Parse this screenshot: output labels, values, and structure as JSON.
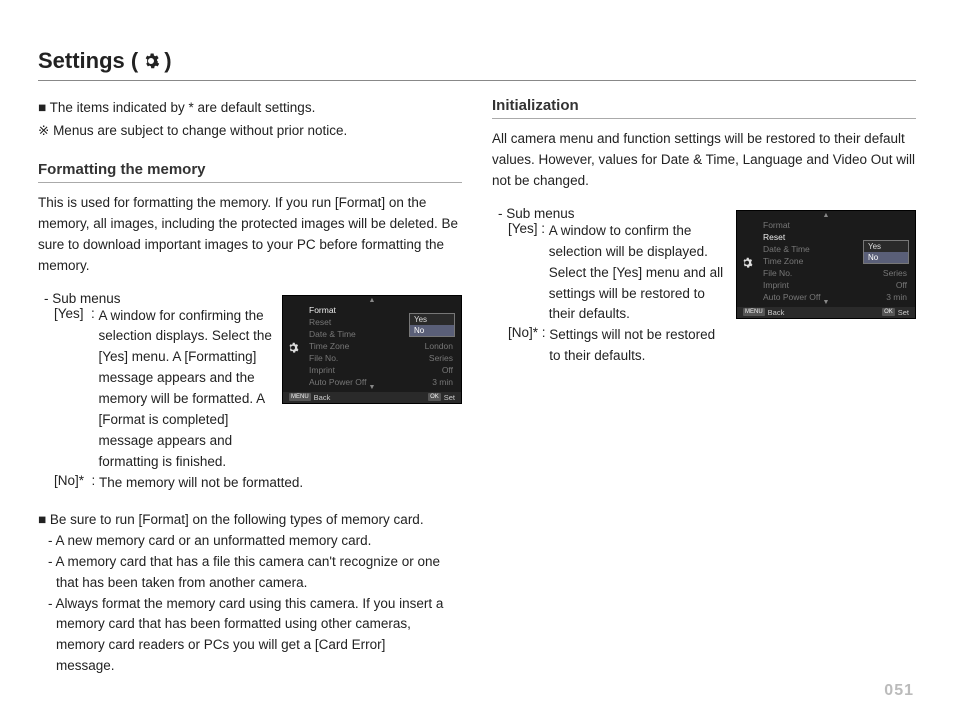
{
  "title_prefix": "Settings ( ",
  "title_suffix": " )",
  "left": {
    "note1_prefix": "■ ",
    "note1": "The items indicated by * are default settings.",
    "note2_prefix": "※ ",
    "note2": "Menus are subject to change without prior notice.",
    "h_format": "Formatting the memory",
    "format_desc": "This is used for formatting the memory. If you run [Format] on the memory, all images, including the protected images will be deleted. Be sure to download important images to your PC before formatting the memory.",
    "sub_label": "- Sub menus",
    "yes_key": "[Yes]  : ",
    "yes_val": "A window for confirming the selection displays. Select the [Yes] menu. A [Formatting] message appears and the memory will be formatted. A [Format is completed] message appears and formatting is finished.",
    "no_key": "[No]*  : ",
    "no_val": "The memory will not be formatted.",
    "n2_lead_prefix": "■ ",
    "n2_lead": "Be sure to run [Format] on the following types of memory card.",
    "n2_a": "- A new memory card or an unformatted memory card.",
    "n2_b": "- A memory card that has a file this camera can't recognize or one",
    "n2_b2": "that has been taken from another camera.",
    "n2_c": "- Always format the memory card using this camera. If you insert a",
    "n2_c2": "memory card that has been formatted using other cameras,",
    "n2_c3": "memory card readers or PCs you will get a [Card Error]",
    "n2_c4": "message."
  },
  "right": {
    "h_init": "Initialization",
    "init_desc": "All camera menu and function settings will be restored to their default values. However, values for Date & Time, Language and Video Out will not be changed.",
    "sub_label": "- Sub menus",
    "yes_key": "[Yes] : ",
    "yes_val": "A window to confirm the selection will be displayed. Select the [Yes] menu and all settings will be restored to their defaults.",
    "no_key": "[No]* : ",
    "no_val": "Settings will not be restored to their defaults."
  },
  "cam_menu": {
    "items": [
      {
        "label": "Format",
        "value": ""
      },
      {
        "label": "Reset",
        "value": ""
      },
      {
        "label": "Date & Time",
        "value": ""
      },
      {
        "label": "Time Zone",
        "value": "London"
      },
      {
        "label": "File No.",
        "value": "Series"
      },
      {
        "label": "Imprint",
        "value": "Off"
      },
      {
        "label": "Auto Power Off",
        "value": "3 min"
      }
    ],
    "opt_yes": "Yes",
    "opt_no": "No",
    "bar_back_key": "MENU",
    "bar_back": "Back",
    "bar_set_key": "OK",
    "bar_set": "Set"
  },
  "cam_menu_left_hot_index": 0,
  "cam_menu_right_hot_index": 1,
  "page_number": "051"
}
